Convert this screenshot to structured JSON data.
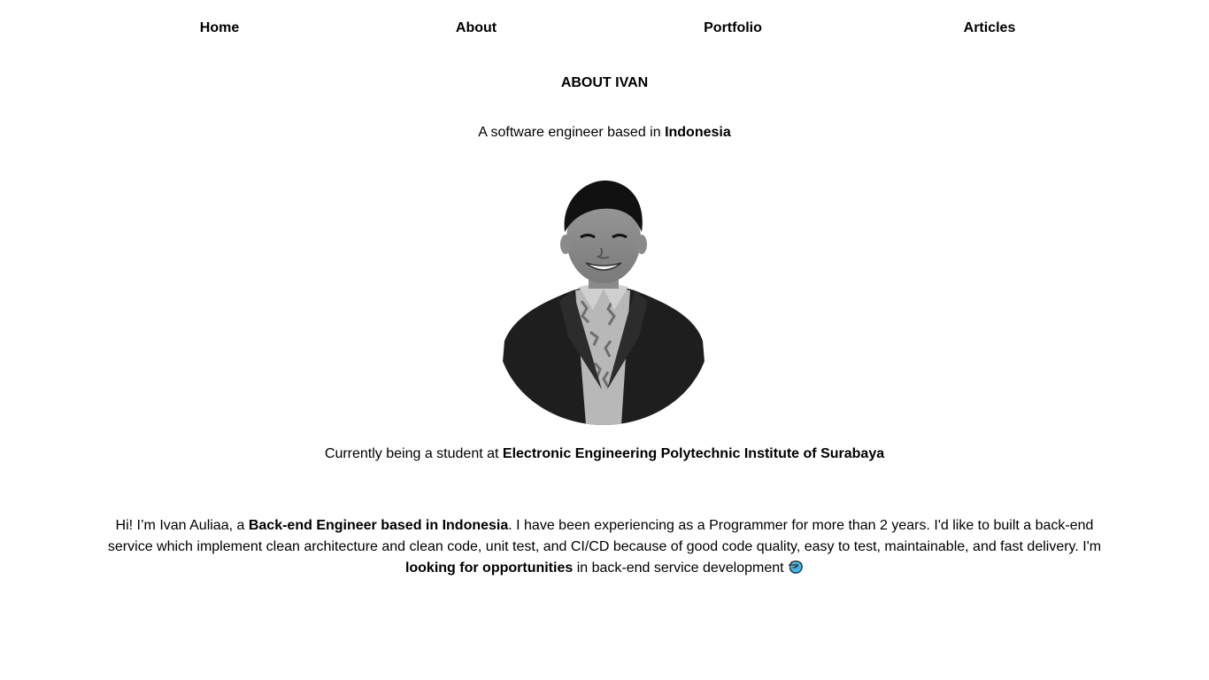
{
  "nav": {
    "home": "Home",
    "about": "About",
    "portfolio": "Portfolio",
    "articles": "Articles"
  },
  "header": {
    "title": "ABOUT IVAN",
    "subtitle_prefix": "A software engineer based in ",
    "subtitle_strong": "Indonesia"
  },
  "photo": {
    "icon": "profile-photo"
  },
  "student": {
    "prefix": "Currently being a student at ",
    "strong": "Electronic Engineering Polytechnic Institute of Surabaya"
  },
  "bio": {
    "part1": "Hi! I’m Ivan Auliaa, a ",
    "strong1": "Back-end Engineer based in Indonesia",
    "part2": ". I have been experiencing as a Programmer for more than 2 years. I'd like to built a back-end service which implement clean architecture and clean code, unit test, and CI/CD because of good code quality, easy to test, maintainable, and fast delivery. I'm ",
    "strong2": "looking for opportunities",
    "part3": " in back-end service development ",
    "emoji_icon": "hand-pointing-icon"
  }
}
